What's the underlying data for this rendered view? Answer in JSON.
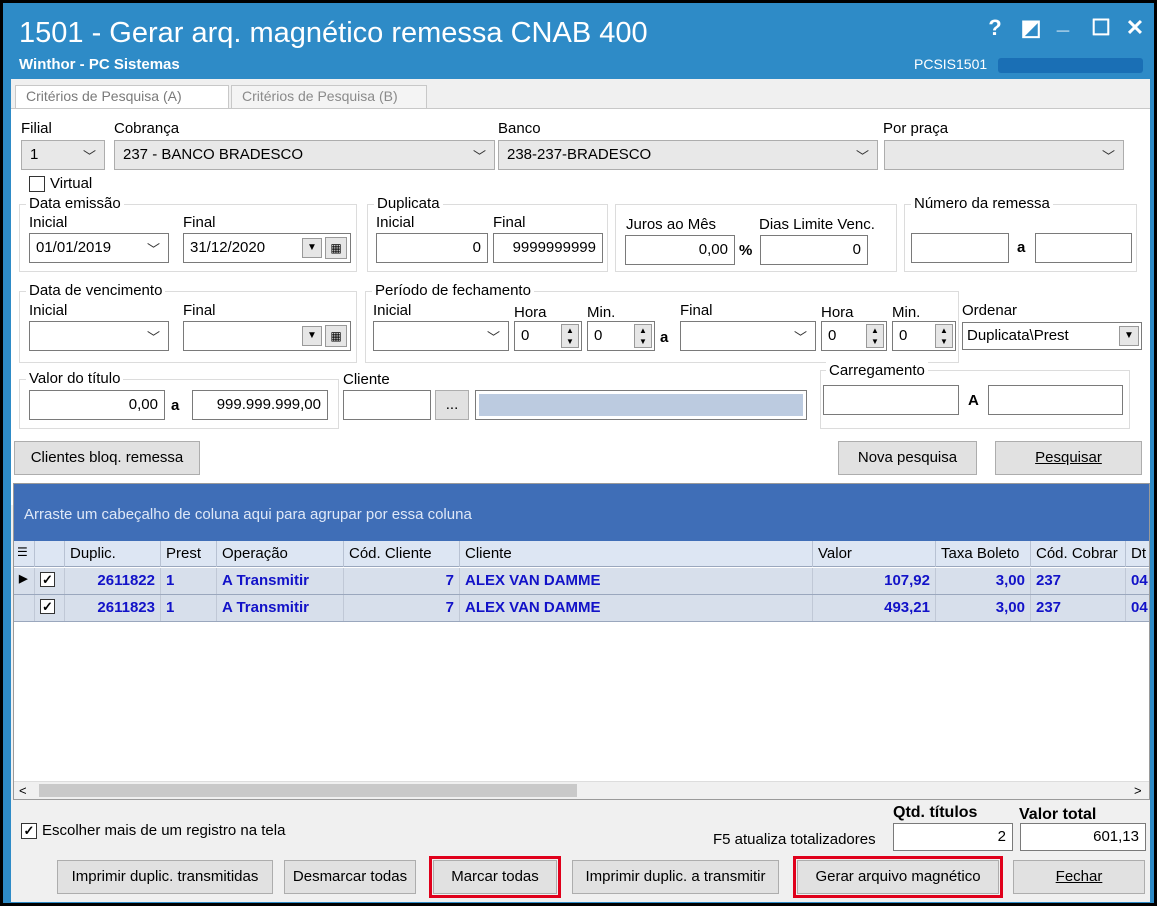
{
  "window": {
    "title": "1501 - Gerar arq. magnético remessa CNAB 400",
    "subtitle": "Winthor - PC Sistemas",
    "code": "PCSIS1501",
    "controls": {
      "help": "?",
      "restore": "◩",
      "minimize": "_",
      "maximize": "☐",
      "close": "✕"
    }
  },
  "tabs": [
    {
      "label": "Critérios de Pesquisa (A)"
    },
    {
      "label": "Critérios de Pesquisa (B)"
    }
  ],
  "filters": {
    "filial": {
      "label": "Filial",
      "value": "1"
    },
    "cobranca": {
      "label": "Cobrança",
      "value": "237 - BANCO BRADESCO"
    },
    "banco": {
      "label": "Banco",
      "value": "238-237-BRADESCO"
    },
    "por_praca": {
      "label": "Por praça",
      "value": ""
    },
    "virtual": {
      "label": "Virtual",
      "checked": false
    },
    "data_emissao": {
      "label": "Data emissão",
      "inicial_label": "Inicial",
      "final_label": "Final",
      "inicial": "01/01/2019",
      "final": "31/12/2020"
    },
    "duplicata": {
      "label": "Duplicata",
      "inicial_label": "Inicial",
      "final_label": "Final",
      "inicial": "0",
      "final": "9999999999"
    },
    "juros": {
      "label": "Juros ao Mês",
      "value": "0,00",
      "unit": "%"
    },
    "dias_limite": {
      "label": "Dias Limite Venc.",
      "value": "0"
    },
    "numero_remessa": {
      "label": "Número da remessa",
      "sep": "a",
      "from": "",
      "to": ""
    },
    "data_vencimento": {
      "label": "Data de vencimento",
      "inicial_label": "Inicial",
      "final_label": "Final",
      "inicial": "",
      "final": ""
    },
    "periodo": {
      "label": "Período de fechamento",
      "inicial_label": "Inicial",
      "hora_label": "Hora",
      "min_label": "Min.",
      "final_label": "Final",
      "sep": "a",
      "hora1": "0",
      "min1": "0",
      "hora2": "0",
      "min2": "0"
    },
    "ordenar": {
      "label": "Ordenar",
      "value": "Duplicata\\Prest"
    },
    "valor_titulo": {
      "label": "Valor do título",
      "from": "0,00",
      "sep": "a",
      "to": "999.999.999,00"
    },
    "cliente": {
      "label": "Cliente",
      "code": "",
      "browse": "...",
      "name": ""
    },
    "carregamento": {
      "label": "Carregamento",
      "sep": "A",
      "from": "",
      "to": ""
    }
  },
  "actions": {
    "clientes_bloq": "Clientes bloq. remessa",
    "nova_pesquisa": "Nova pesquisa",
    "pesquisar": "Pesquisar"
  },
  "grid": {
    "group_hint": "Arraste um cabeçalho de coluna aqui para agrupar por essa coluna",
    "columns": [
      "Duplic.",
      "Prest",
      "Operação",
      "Cód. Cliente",
      "Cliente",
      "Valor",
      "Taxa Boleto",
      "Cód. Cobrar",
      "Dt"
    ],
    "rows": [
      {
        "checked": true,
        "current": true,
        "duplic": "2611822",
        "prest": "1",
        "operacao": "A Transmitir",
        "cod_cliente": "7",
        "cliente": "ALEX VAN DAMME",
        "valor": "107,92",
        "taxa": "3,00",
        "cod_cobranca": "237",
        "dt": "04"
      },
      {
        "checked": true,
        "current": false,
        "duplic": "2611823",
        "prest": "1",
        "operacao": "A Transmitir",
        "cod_cliente": "7",
        "cliente": "ALEX VAN DAMME",
        "valor": "493,21",
        "taxa": "3,00",
        "cod_cobranca": "237",
        "dt": "04"
      }
    ]
  },
  "footer": {
    "multi_select": {
      "label": "Escolher mais de um registro na tela",
      "checked": true
    },
    "f5_hint": "F5 atualiza totalizadores",
    "qtd_label": "Qtd. títulos",
    "qtd_value": "2",
    "total_label": "Valor total",
    "total_value": "601,13",
    "buttons": {
      "imprimir_transmitidas": "Imprimir duplic. transmitidas",
      "desmarcar": "Desmarcar todas",
      "marcar": "Marcar todas",
      "imprimir_transmitir": "Imprimir duplic. a transmitir",
      "gerar": "Gerar arquivo magnético",
      "fechar": "Fechar"
    }
  },
  "colors": {
    "title_bar": "#2e8bc7",
    "group_bar": "#3f6eb7",
    "data_text": "#1212c8",
    "highlight": "#e0001b"
  }
}
